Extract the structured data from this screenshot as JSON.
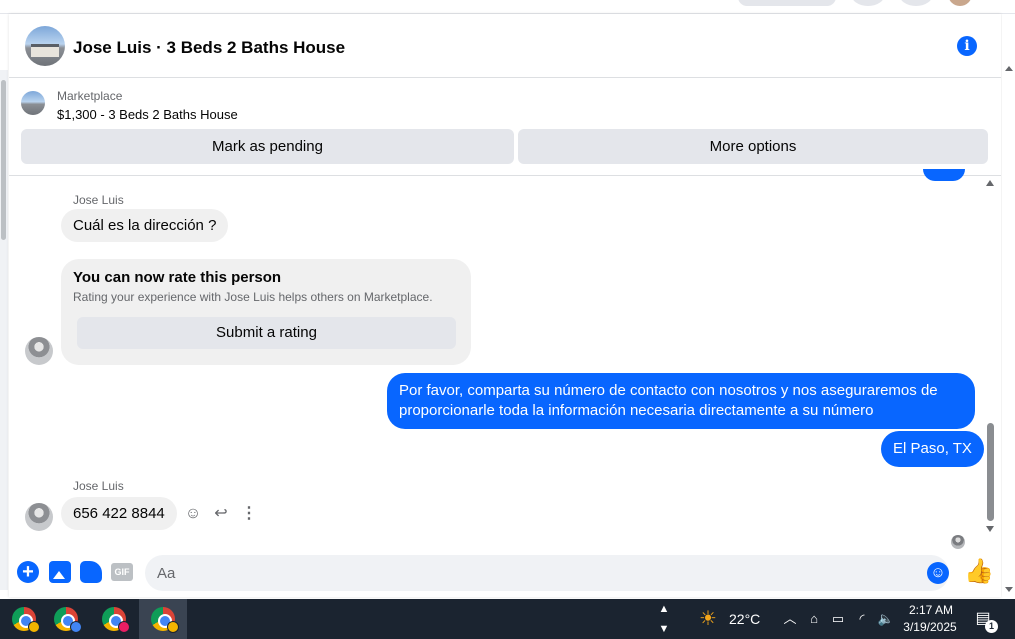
{
  "header": {
    "title": "Jose Luis · 3 Beds 2 Baths House"
  },
  "listing": {
    "source": "Marketplace",
    "title": "$1,300 - 3 Beds 2 Baths House",
    "mark_pending_label": "Mark as pending",
    "more_options_label": "More options"
  },
  "messages": {
    "sender_name": "Jose Luis",
    "incoming_1": "Cuál es la dirección ?",
    "rating_card": {
      "title": "You can now rate this person",
      "description": "Rating your experience with Jose Luis helps others on Marketplace.",
      "button_label": "Submit a rating"
    },
    "outgoing_1": "Por favor, comparta su número de contacto con nosotros y nos aseguraremos de proporcionarle toda la información necesaria directamente a su número",
    "outgoing_2": "El Paso, TX",
    "sender_name_2": "Jose Luis",
    "incoming_2": "656 422 8844"
  },
  "composer": {
    "placeholder": "Aa",
    "gif_label": "GIF"
  },
  "taskbar": {
    "apps": [
      {
        "name": "chrome-profile-1",
        "profile_color": "#f4b400"
      },
      {
        "name": "chrome-profile-2",
        "profile_color": "#4285f4"
      },
      {
        "name": "chrome-profile-3",
        "profile_color": "#e91e63"
      },
      {
        "name": "chrome-profile-4",
        "profile_color": "#f4b400"
      }
    ],
    "weather_temp": "22°C",
    "time": "2:17 AM",
    "date": "3/19/2025",
    "notification_count": "1"
  },
  "colors": {
    "accent": "#0866ff",
    "incoming_bubble": "#f0f0f0",
    "button_bg": "#e4e6eb",
    "taskbar_bg": "#1b2430"
  }
}
